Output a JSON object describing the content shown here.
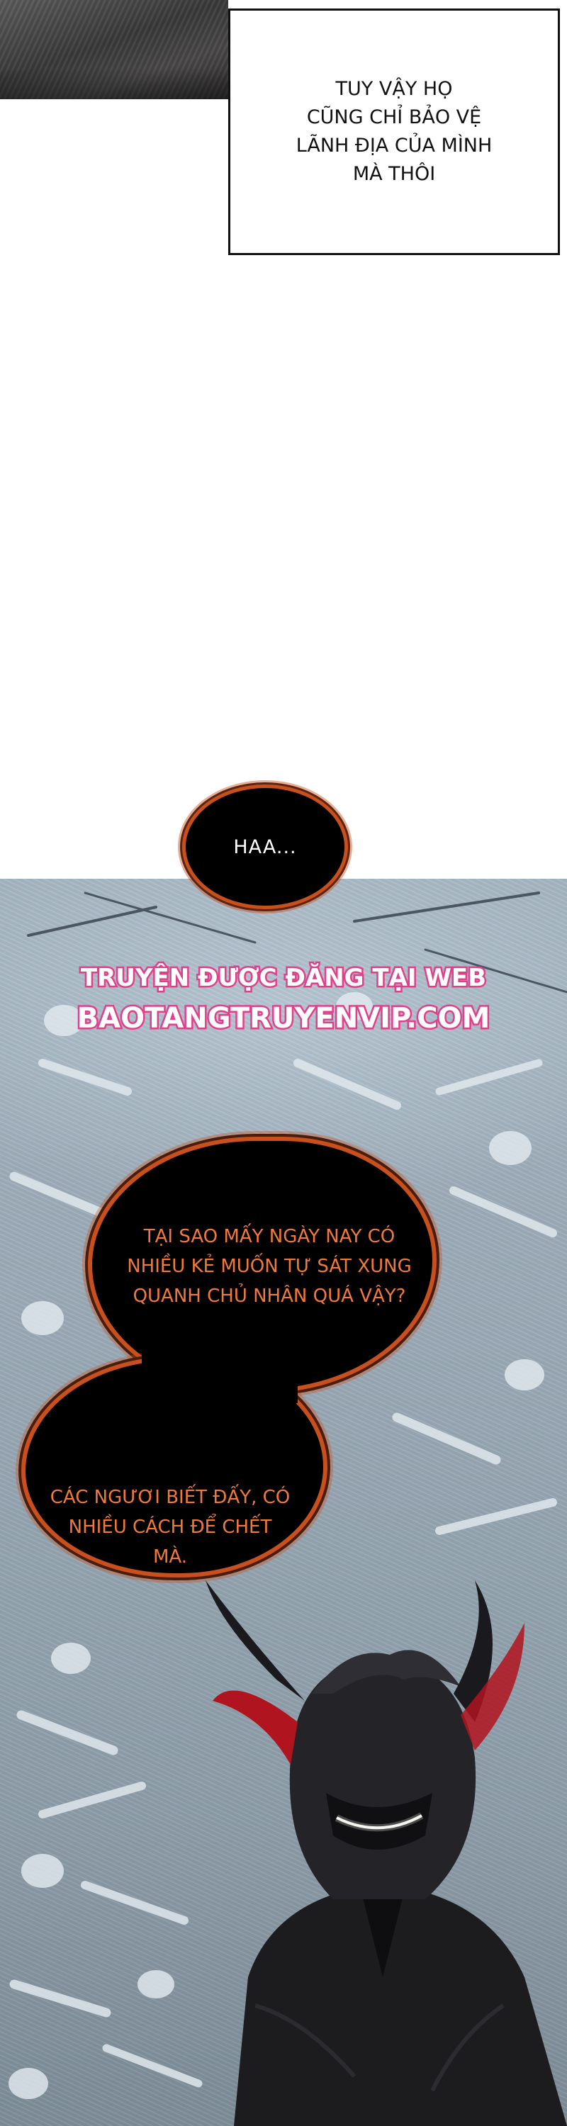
{
  "caption": {
    "text": "Tuy vậy họ\ncũng chỉ bảo vệ\nlãnh địa của mình\nmà thôi"
  },
  "bubble_haa": {
    "text": "HAA..."
  },
  "watermark": {
    "line1": "TRUYỆN ĐƯỢC ĐĂNG TẠI WEB",
    "line2": "BAOTANGTRUYENVIP.COM",
    "color": "#e0408a"
  },
  "bubble_1": {
    "text": "Tại sao mấy ngày nay có\nnhiều kẻ muốn tự sát xung\nquanh chủ nhân quá vậy?"
  },
  "bubble_2": {
    "text": "Các ngươi biết đấy, có\nnhiều cách để chết\nmà."
  },
  "colors": {
    "bubble_fill": "#000000",
    "bubble_outline": "#c8501e",
    "bubble_text": "#f0793c",
    "scene_background": "#9aaab6",
    "mask_accent": "#b0141e"
  }
}
